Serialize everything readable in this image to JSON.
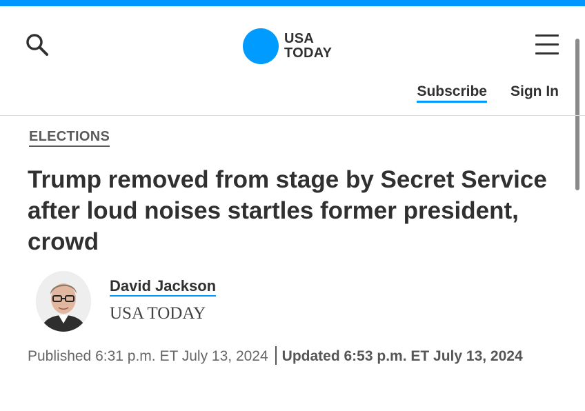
{
  "colors": {
    "accent": "#009bff",
    "top_bar": "#0098fe",
    "text": "#303030"
  },
  "header": {
    "logo_line1": "USA",
    "logo_line2": "TODAY",
    "search_icon": "search-icon",
    "menu_icon": "hamburger-menu-icon",
    "subscribe_label": "Subscribe",
    "signin_label": "Sign In"
  },
  "article": {
    "section": "ELECTIONS",
    "headline": "Trump removed from stage by Secret Service after loud noises startles former president, crowd",
    "author": {
      "name": "David Jackson",
      "organization": "USA TODAY"
    },
    "published": "Published 6:31 p.m. ET July 13, 2024",
    "updated": "Updated 6:53 p.m. ET July 13, 2024"
  }
}
